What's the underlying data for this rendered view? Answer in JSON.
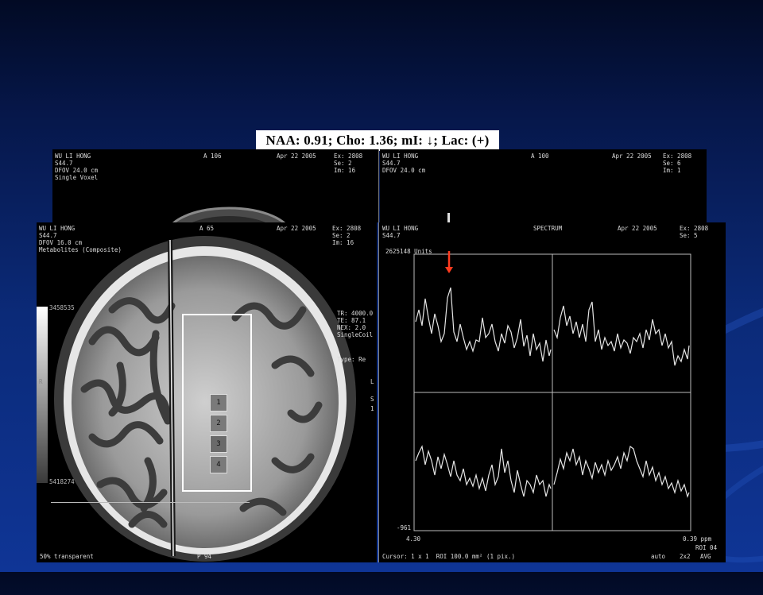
{
  "caption": "NAA: 0.91; Cho: 1.36; mI: ↓; Lac: (+)",
  "back_left": {
    "patient": "WU LI HONG",
    "line2": "S44.7",
    "line3": "DFOV 24.0 cm",
    "line4": "Single Voxel",
    "center": "A 106",
    "date": "Apr 22 2005",
    "ex": "Ex: 2808",
    "se": "Se: 2",
    "im": "Im: 16"
  },
  "back_right": {
    "patient": "WU LI HONG",
    "line2": "S44.7",
    "line3": "DFOV 24.0 cm",
    "center": "A 100",
    "date": "Apr 22 2005",
    "ex": "Ex: 2808",
    "se": "Se: 6",
    "im": "Im: 1"
  },
  "front_left": {
    "patient": "WU LI HONG",
    "line2": "S44.7",
    "line3": "DFOV 16.0 cm",
    "line4": "Metabolites (Composite)",
    "center": "A 65",
    "date": "Apr 22 2005",
    "ex": "Ex: 2808",
    "se": "Se: 2",
    "im": "Im: 16",
    "tr": "TR: 4000.0",
    "te": "TE: 87.1",
    "nex": "NEX: 2.0",
    "coil": "SingleCoil",
    "type": "Type: Re",
    "l": "L",
    "s": "S",
    "one": "1",
    "scale_top": "3458535",
    "scale_mid": "R",
    "scale_bottom": "5418274",
    "transparent": "50% transparent",
    "p_label": "P 94",
    "voxels": [
      "1",
      "2",
      "3",
      "4"
    ]
  },
  "front_right": {
    "patient": "WU LI HONG",
    "line2": "S44.7",
    "center": "SPECTRUM",
    "date": "Apr 22 2005",
    "ex": "Ex: 2808",
    "se": "Se: 5",
    "units": "2625148 Units",
    "ymin": "-961",
    "xleft": "4.30",
    "xright": "0.39 ppm",
    "roi": "ROI 04",
    "cursor": "Cursor: 1 x 1  ROI 100.0 mm² (1 pix.)",
    "auto": "auto",
    "grid": "2x2",
    "avg": "AVG"
  },
  "colors": {
    "arrow": "#ff3b1f",
    "background": "#0b2a78"
  }
}
